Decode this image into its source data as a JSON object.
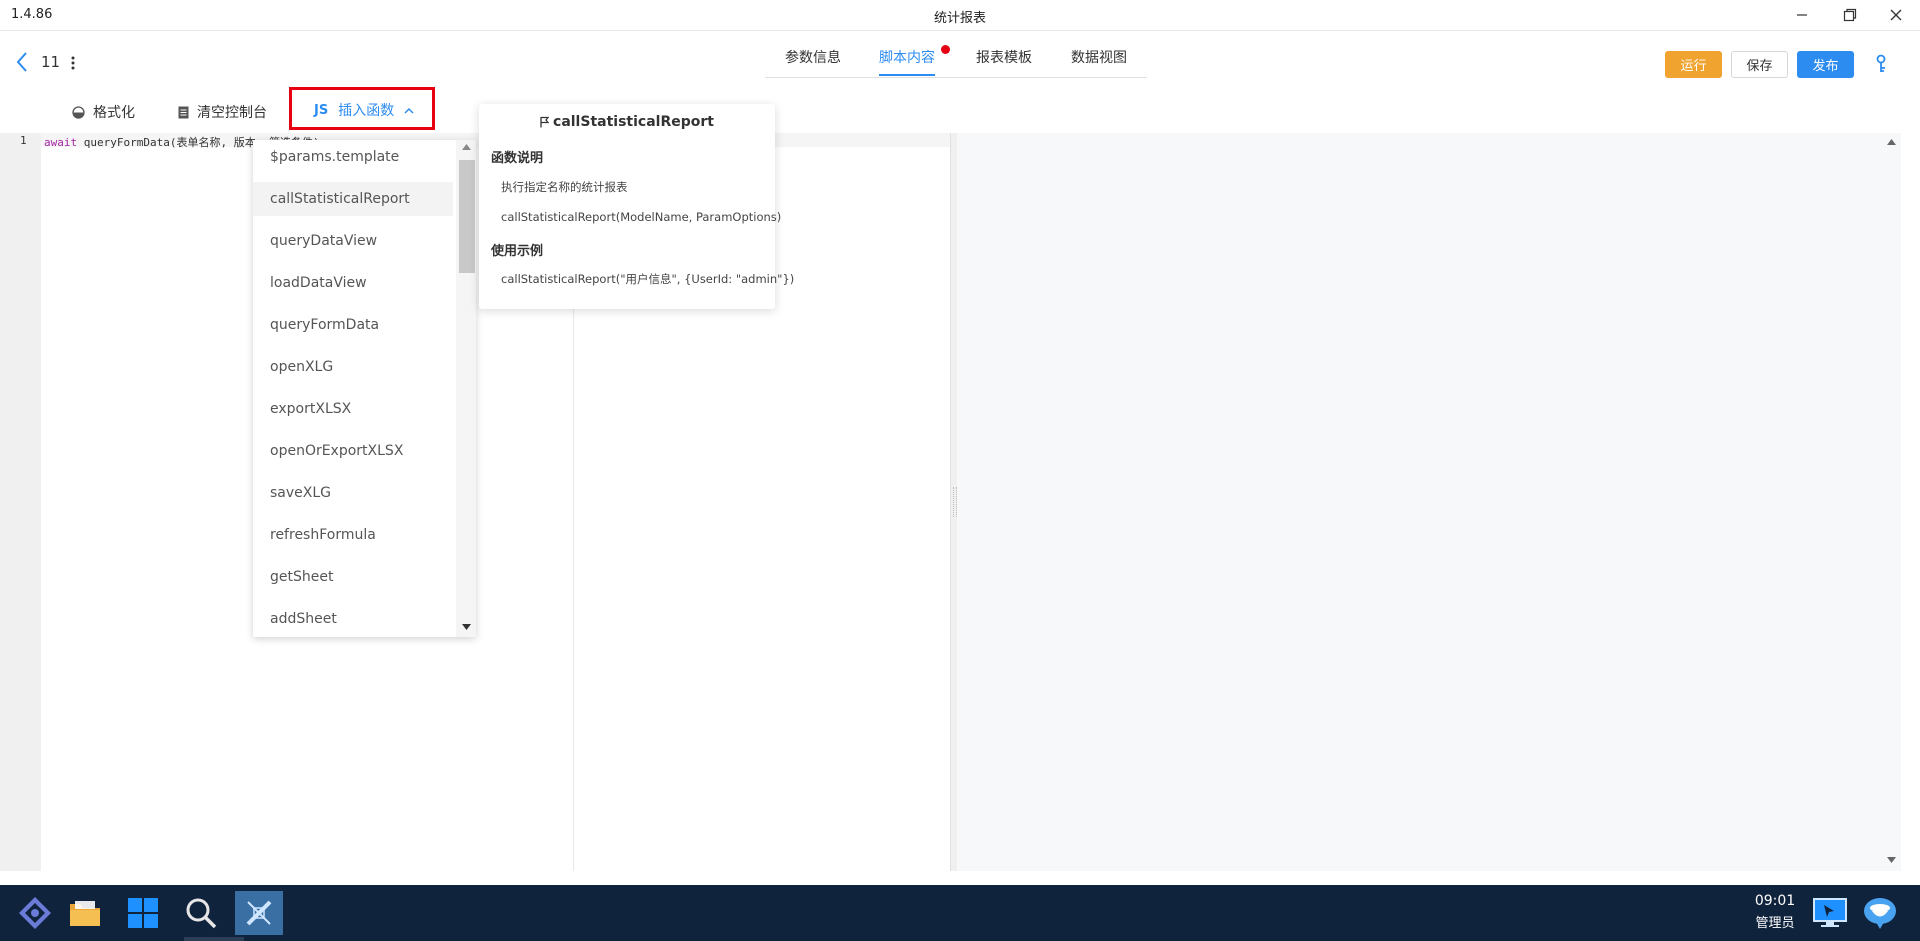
{
  "window": {
    "version": "1.4.86",
    "title": "统计报表"
  },
  "header": {
    "doc_number": "11",
    "tabs": [
      {
        "label": "参数信息",
        "active": false
      },
      {
        "label": "脚本内容",
        "active": true,
        "badge_color": "#e60012"
      },
      {
        "label": "报表模板",
        "active": false
      },
      {
        "label": "数据视图",
        "active": false
      }
    ],
    "buttons": {
      "run": "运行",
      "save": "保存",
      "publish": "发布"
    },
    "colors": {
      "accent": "#2d8cf0",
      "run": "#f0a32f"
    }
  },
  "editor_toolbar": {
    "format": "格式化",
    "clear_console": "清空控制台",
    "insert_badge": "JS",
    "insert_function": "插入函数"
  },
  "editor": {
    "line_number": "1",
    "code_keyword": "await",
    "code_rest": " queryFormData(表单名称, 版本, 筛选条件)"
  },
  "dropdown": {
    "items": [
      "$params.template",
      "callStatisticalReport",
      "queryDataView",
      "loadDataView",
      "queryFormData",
      "openXLG",
      "exportXLSX",
      "openOrExportXLSX",
      "saveXLG",
      "refreshFormula",
      "getSheet",
      "addSheet"
    ],
    "hovered": "callStatisticalReport"
  },
  "popover": {
    "title": "callStatisticalReport",
    "desc_heading": "函数说明",
    "desc_text": "执行指定名称的统计报表",
    "signature": "callStatisticalReport(ModelName, ParamOptions)",
    "example_heading": "使用示例",
    "example": "callStatisticalReport(\"用户信息\", {UserId: \"admin\"})"
  },
  "taskbar": {
    "time": "09:01",
    "user": "管理员",
    "icons": [
      "app-launcher-icon",
      "folder-icon",
      "windows-grid-icon",
      "search-icon",
      "design-tool-icon"
    ]
  }
}
